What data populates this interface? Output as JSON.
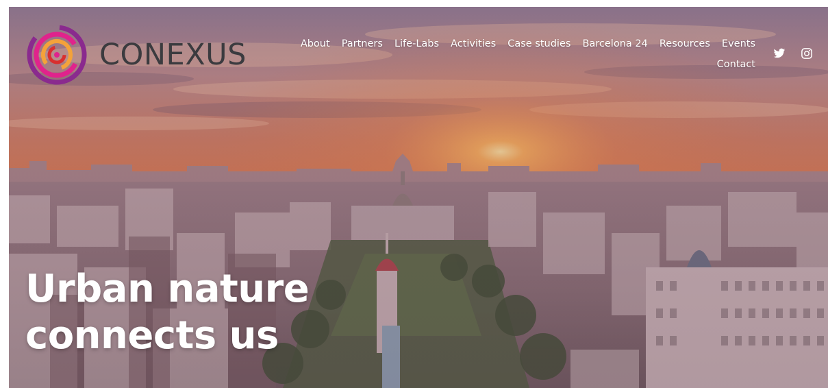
{
  "brand": {
    "name": "CONEXUS",
    "accent_colors": [
      "#e0238c",
      "#7b2a8c",
      "#f4a23a",
      "#d92f2f"
    ]
  },
  "nav": {
    "items": [
      {
        "label": "About"
      },
      {
        "label": "Partners"
      },
      {
        "label": "Life-Labs"
      },
      {
        "label": "Activities"
      },
      {
        "label": "Case studies"
      },
      {
        "label": "Barcelona 24"
      },
      {
        "label": "Resources"
      },
      {
        "label": "Events"
      },
      {
        "label": "Contact"
      }
    ]
  },
  "social": {
    "icons": [
      "twitter-icon",
      "instagram-icon"
    ]
  },
  "hero": {
    "headline_line1": "Urban nature",
    "headline_line2": "connects us",
    "background": "sunset city skyline with green boulevard"
  }
}
